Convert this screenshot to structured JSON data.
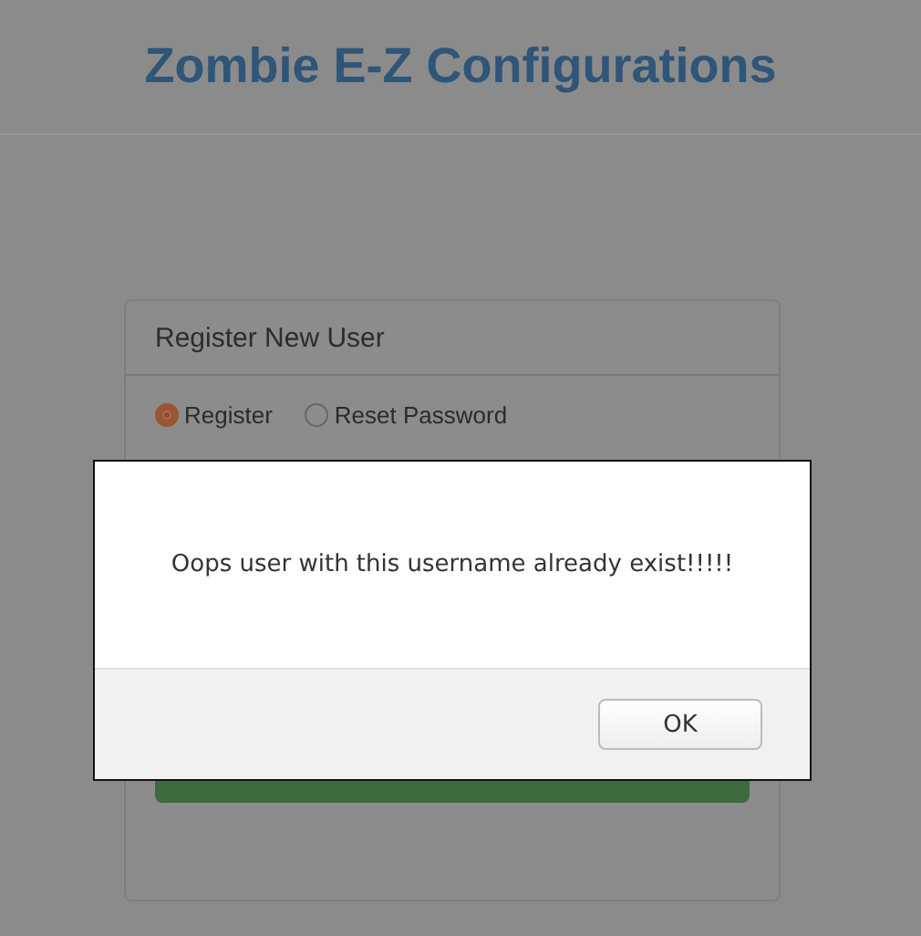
{
  "header": {
    "title": "Zombie E-Z Configurations"
  },
  "panel": {
    "title": "Register New User",
    "modes": [
      {
        "label": "Register",
        "selected": true
      },
      {
        "label": "Reset Password",
        "selected": false
      }
    ]
  },
  "dialog": {
    "message": "Oops user with this username already exist!!!!!",
    "buttons": [
      "OK"
    ]
  }
}
